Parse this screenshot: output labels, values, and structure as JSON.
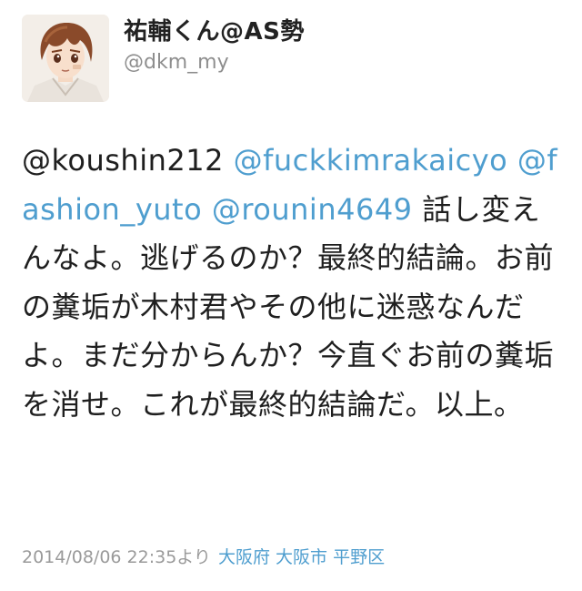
{
  "author": {
    "display_name": "祐輔くん@AS勢",
    "handle": "@dkm_my",
    "avatar_icon": "anime-boy-avatar-icon"
  },
  "tweet": {
    "mentions": [
      "@koushin212",
      "@fuckkimrakaicyo",
      "@fashion_yuto",
      "@rounin4649"
    ],
    "text": "話し変えんなよ。逃げるのか？最終的結論。お前の糞垢が木村君やその他に迷惑なんだよ。まだ分からんか？今直ぐお前の糞垢を消せ。これが最終的結論だ。以上。"
  },
  "footer": {
    "timestamp": "2014/08/06 22:35より",
    "location": "大阪府 大阪市 平野区"
  },
  "colors": {
    "link": "#4f9ecf",
    "text": "#1f1f1f",
    "muted": "#9a9a9a"
  }
}
